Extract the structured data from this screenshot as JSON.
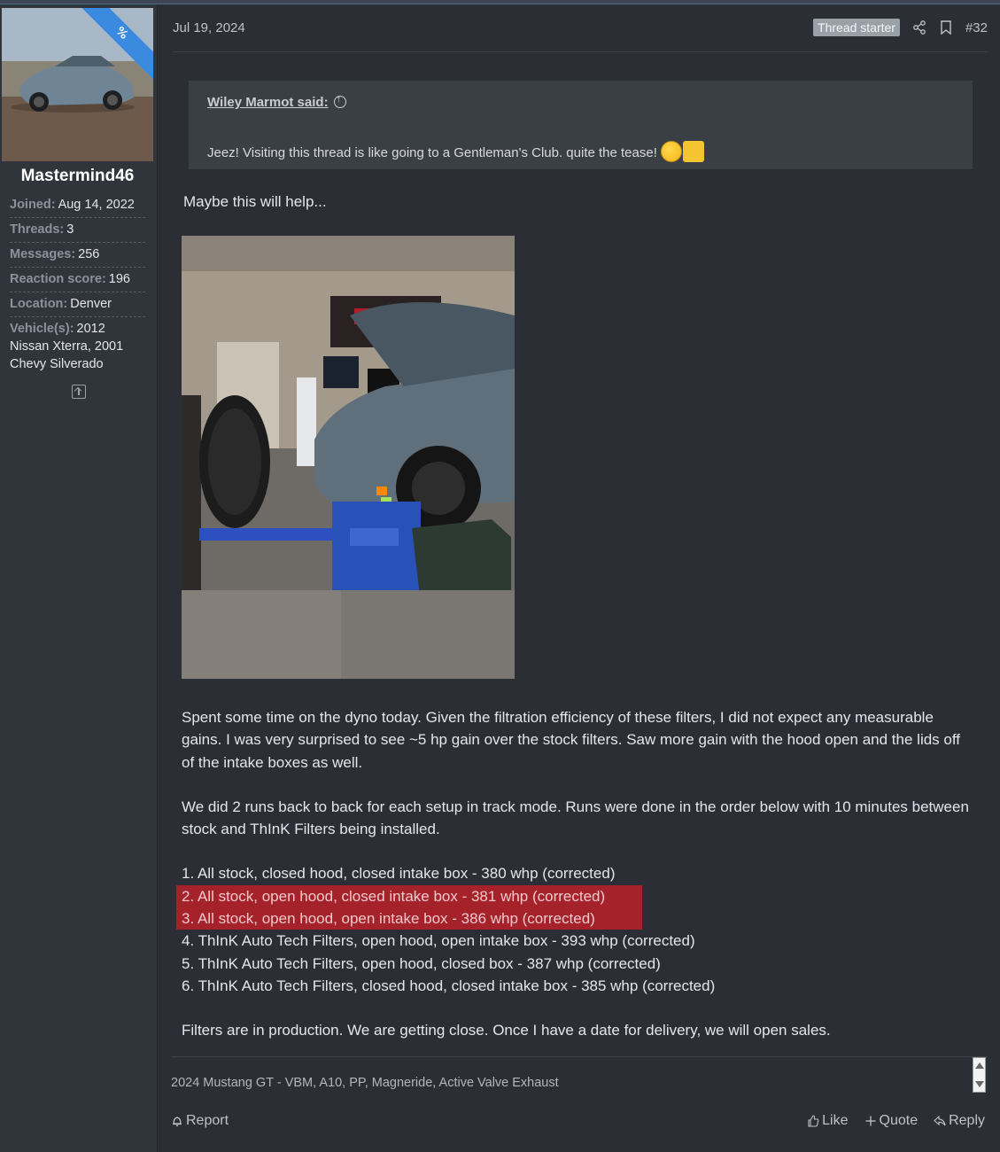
{
  "user": {
    "name": "Mastermind46",
    "avatar_badge": "%",
    "stats": [
      {
        "key": "Joined:",
        "value": "Aug 14, 2022"
      },
      {
        "key": "Threads:",
        "value": "3"
      },
      {
        "key": "Messages:",
        "value": "256"
      },
      {
        "key": "Reaction score:",
        "value": "196"
      },
      {
        "key": "Location:",
        "value": "Denver"
      },
      {
        "key": "Vehicle(s):",
        "value": "2012 Nissan Xterra, 2001 Chevy Silverado"
      }
    ]
  },
  "post": {
    "date": "Jul 19, 2024",
    "badge": "Thread starter",
    "number": "#32",
    "quote": {
      "author": "Wiley Marmot said:",
      "text": "Jeez! Visiting this thread is like going to a Gentleman's Club. quite the tease!"
    },
    "intro": "Maybe this will help...",
    "paragraph1": "Spent some time on the dyno today. Given the filtration efficiency of these filters, I did not expect any measurable gains. I was very surprised to see ~5 hp gain over the stock filters. Saw more gain with the hood open and the lids off of the intake boxes as well.",
    "paragraph2": "We did 2 runs back to back for each setup in track mode. Runs were done in the order below with 10 minutes between stock and ThInK Filters being installed.",
    "list": [
      "1. All stock, closed hood, closed intake box - 380 whp (corrected)",
      "2. All stock, open hood, closed intake box - 381 whp (corrected)",
      "3. All stock, open hood, open intake box - 386 whp (corrected)",
      "4. ThInK Auto Tech Filters, open hood, open intake box - 393 whp (corrected)",
      "5. ThInK Auto Tech Filters, open hood, closed box - 387 whp (corrected)",
      "6. ThInK Auto Tech Filters, closed hood, closed intake box - 385 whp (corrected)"
    ],
    "closing": "Filters are in production. We are getting close. Once I have a date for delivery, we will open sales.",
    "signature": "2024 Mustang GT - VBM, A10, PP, Magneride, Active Valve Exhaust"
  },
  "actions": {
    "report": "Report",
    "like": "Like",
    "quote": "Quote",
    "reply": "Reply"
  },
  "colors": {
    "highlight": "#a5222b",
    "page_bg": "#2b2f35",
    "sidebar_bg": "#30353c",
    "ribbon": "#3a8be0"
  }
}
